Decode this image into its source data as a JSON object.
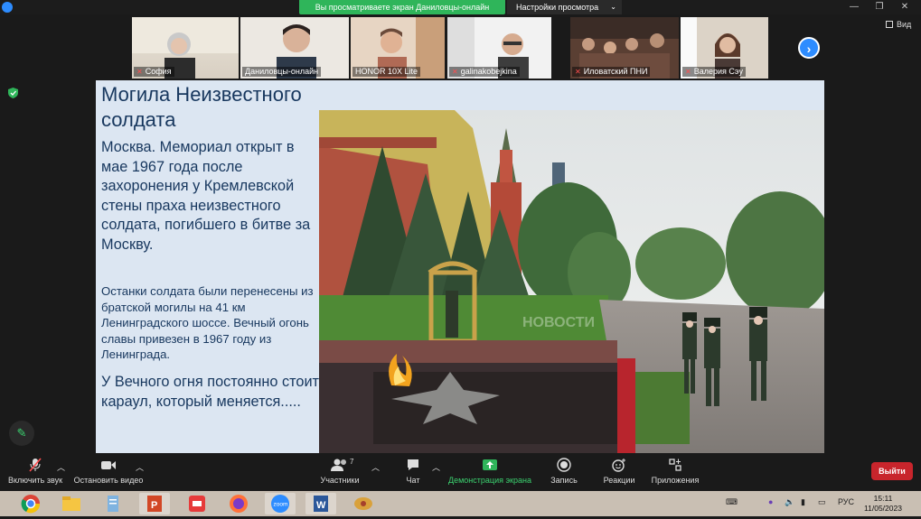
{
  "topbar": {
    "share_banner": "Вы просматриваете экран Даниловцы-онлайн",
    "view_settings": "Настройки просмотра",
    "view_label": "Вид"
  },
  "participants": [
    {
      "name": "София",
      "muted": true
    },
    {
      "name": "Даниловцы-онлайн",
      "muted": false
    },
    {
      "name": "HONOR 10X Lite",
      "muted": false
    },
    {
      "name": "galinakobejkina",
      "muted": true
    },
    {
      "name": "Иловатский ПНИ",
      "muted": true
    },
    {
      "name": "Валерия Сэу",
      "muted": true
    }
  ],
  "slide": {
    "title": "Могила Неизвестного солдата",
    "body1": "Москва. Мемориал открыт в мае 1967 года после захоронения у Кремлевской стены праха неизвестного солдата, погибшего в битве за Москву.",
    "body2": "Останки солдата были перенесены из братской могилы на 41 км Ленинградского шоссе. Вечный огонь славы привезен в 1967 году из Ленинграда.",
    "body3": "У Вечного огня постоянно стоит караул, который меняется.....",
    "watermark": "НОВОСТИ"
  },
  "controls": {
    "audio": "Включить звук",
    "video": "Остановить видео",
    "participants": "Участники",
    "participants_count": "7",
    "chat": "Чат",
    "share": "Демонстрация экрана",
    "record": "Запись",
    "reactions": "Реакции",
    "apps": "Приложения",
    "leave": "Выйти"
  },
  "taskbar": {
    "lang": "РУС",
    "time": "15:11",
    "date": "11/05/2023"
  },
  "colors": {
    "share_green": "#2fb55a",
    "slide_text": "#17375e",
    "slide_bg": "#dce6f2",
    "leave_red": "#c8252c",
    "zoom_blue": "#2d8cff"
  }
}
